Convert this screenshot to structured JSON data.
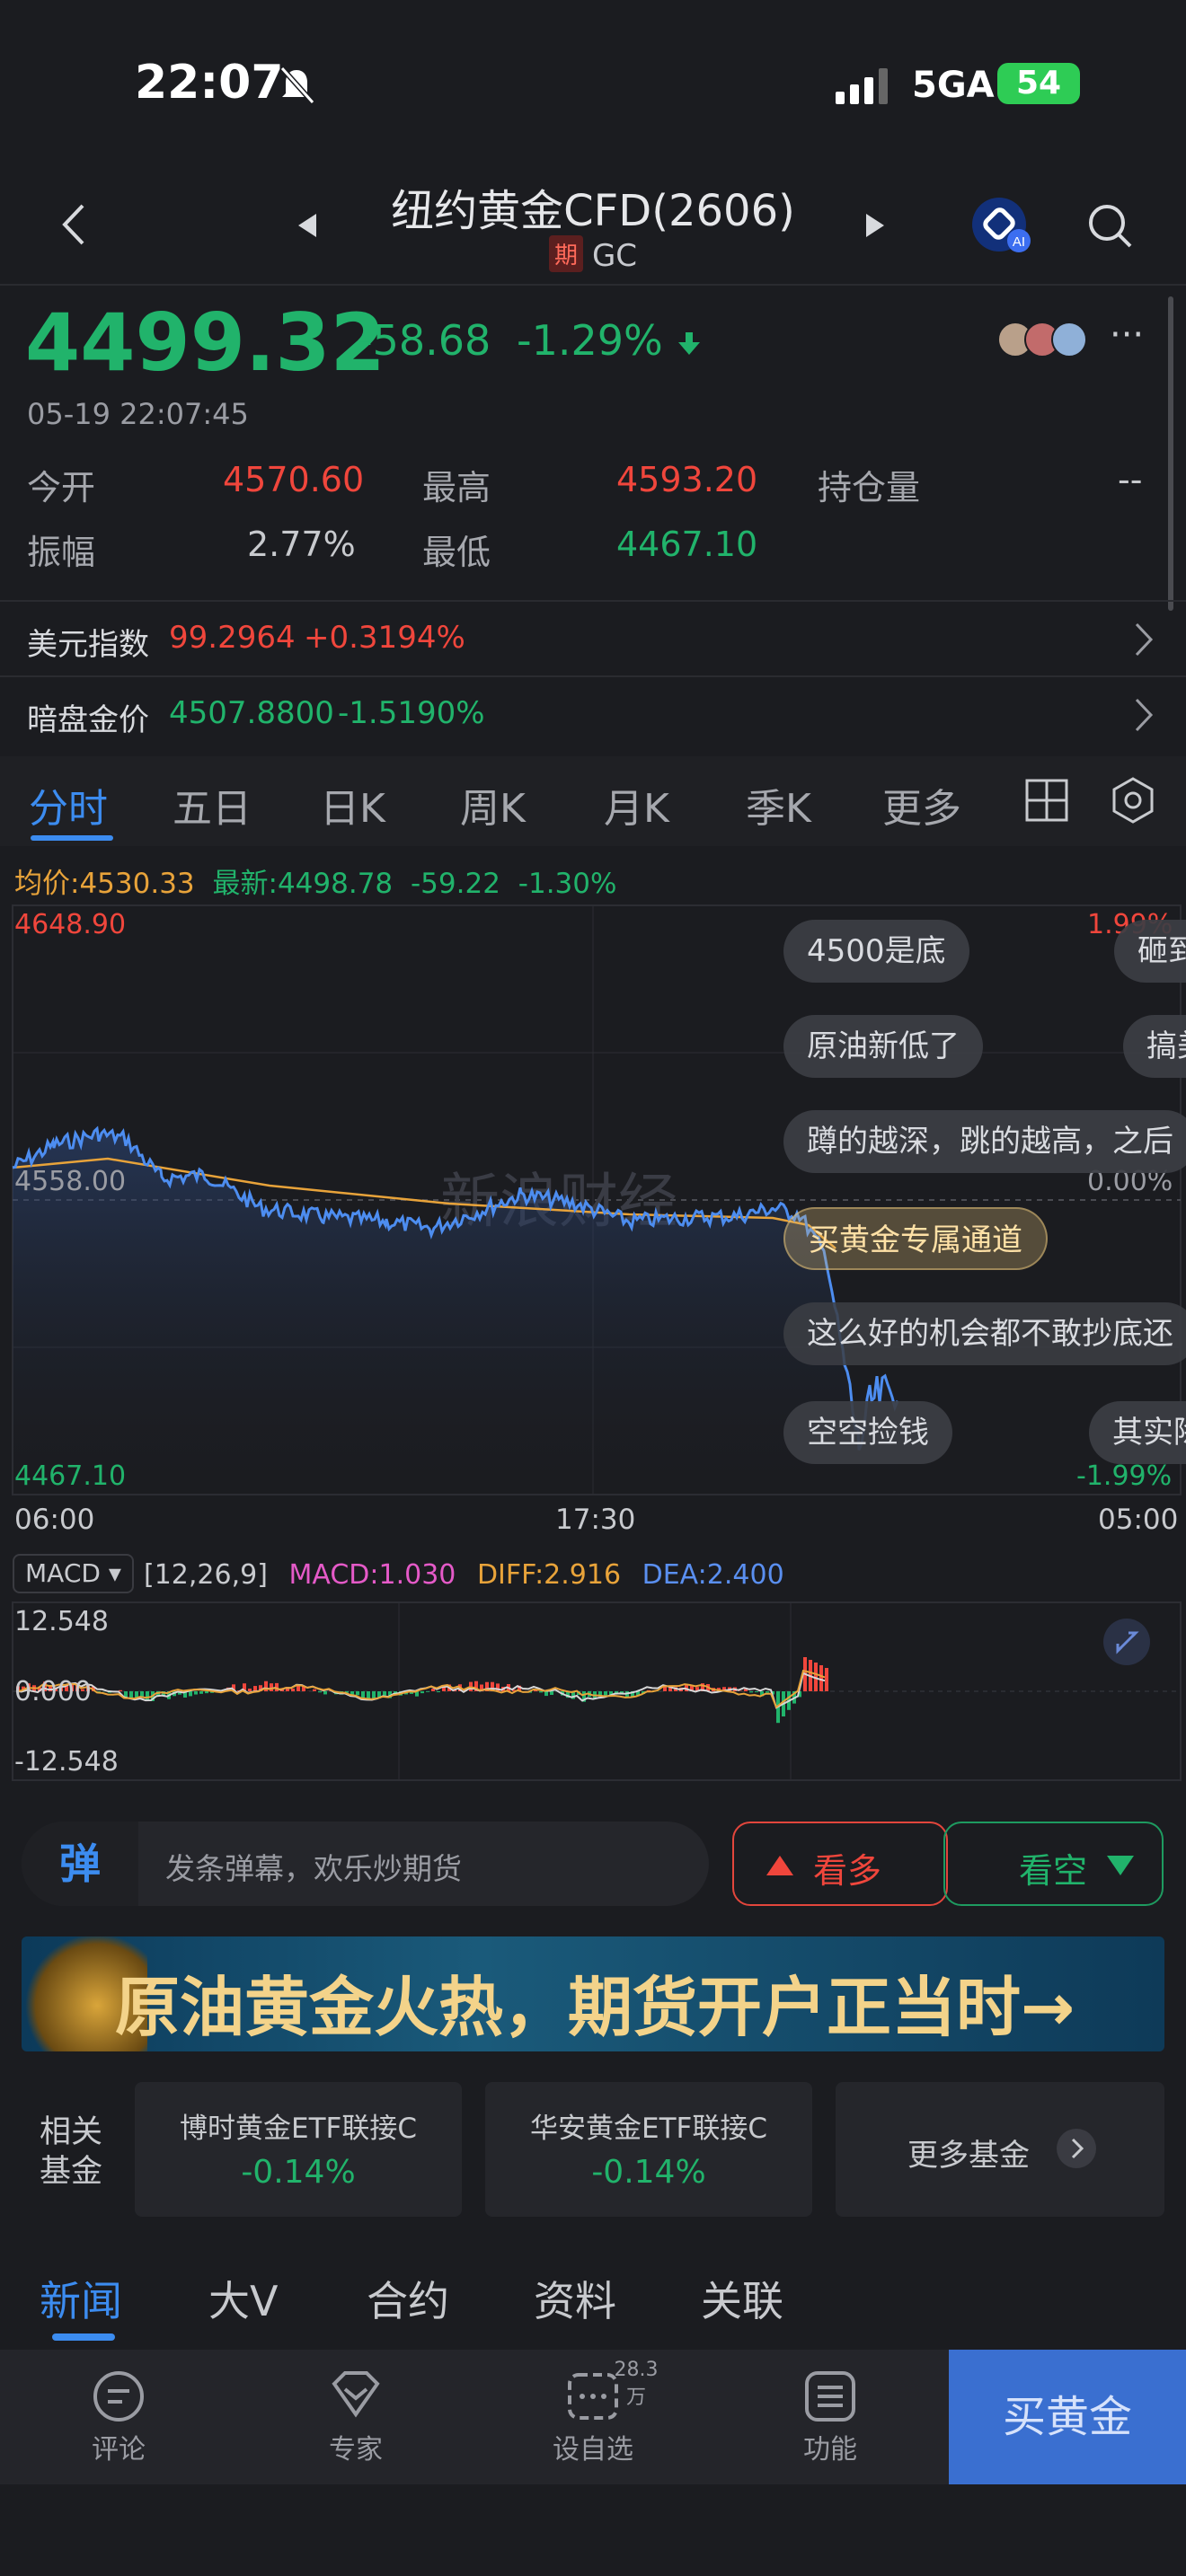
{
  "status": {
    "time": "22:07",
    "network": "5GA",
    "battery": "54"
  },
  "header": {
    "title": "纽约黄金CFD(2606)",
    "tag": "期",
    "code": "GC"
  },
  "quote": {
    "price": "4499.32",
    "change": "-58.68",
    "change_pct": "-1.29%",
    "timestamp": "05-19 22:07:45",
    "open_label": "今开",
    "open": "4570.60",
    "high_label": "最高",
    "high": "4593.20",
    "oi_label": "持仓量",
    "oi": "--",
    "amp_label": "振幅",
    "amp": "2.77%",
    "low_label": "最低",
    "low": "4467.10"
  },
  "usd_index": {
    "label": "美元指数",
    "value": "99.2964",
    "change": "+0.3194%"
  },
  "dark_gold": {
    "label": "暗盘金价",
    "value": "4507.8800",
    "change": "-1.5190%"
  },
  "tabs": [
    "分时",
    "五日",
    "日K",
    "周K",
    "月K",
    "季K",
    "更多"
  ],
  "chart_info": {
    "avg": "均价:4530.33",
    "latest": "最新:4498.78",
    "change": "-59.22",
    "pct": "-1.30%"
  },
  "chart_labels": {
    "y_top": "4648.90",
    "y_mid": "4558.00",
    "y_bot": "4467.10",
    "pct_top": "1.99%",
    "pct_mid": "0.00%",
    "pct_bot": "-1.99%",
    "x_start": "06:00",
    "x_mid": "17:30",
    "x_end": "05:00",
    "watermark": "新浪财经"
  },
  "danmu": [
    {
      "text": "4500是底"
    },
    {
      "text": "砸到"
    },
    {
      "text": "原油新低了"
    },
    {
      "text": "搞美"
    },
    {
      "text": "蹲的越深，跳的越高，之后"
    },
    {
      "text": "买黄金专属通道"
    },
    {
      "text": "这么好的机会都不敢抄底还"
    },
    {
      "text": "空空捡钱"
    },
    {
      "text": "其实除"
    }
  ],
  "macd": {
    "selector": "MACD",
    "params": "[12,26,9]",
    "macd": "MACD:1.030",
    "diff": "DIFF:2.916",
    "dea": "DEA:2.400",
    "y_top": "12.548",
    "y_mid": "0.000",
    "y_bot": "-12.548"
  },
  "comment": {
    "icon_text": "弹",
    "placeholder": "发条弹幕，欢乐炒期货"
  },
  "bull": "看多",
  "bear": "看空",
  "banner": {
    "text": "原油黄金火热，期货开户正当时→"
  },
  "funds": {
    "label": "相关\n基金",
    "items": [
      {
        "name": "博时黄金ETF联接C",
        "change": "-0.14%"
      },
      {
        "name": "华安黄金ETF联接C",
        "change": "-0.14%"
      }
    ],
    "more": "更多基金"
  },
  "bottom_tabs": [
    "新闻",
    "大V",
    "合约",
    "资料",
    "关联"
  ],
  "nav": {
    "comment": "评论",
    "expert": "专家",
    "watchlist": "设自选",
    "watch_count": "28.3万",
    "function": "功能",
    "buy": "买黄金"
  },
  "colors": {
    "up": "#f0463c",
    "down": "#21b36b",
    "accent": "#3c8cf0",
    "avg_line": "#e8a33a",
    "price_line": "#4d8df0"
  }
}
